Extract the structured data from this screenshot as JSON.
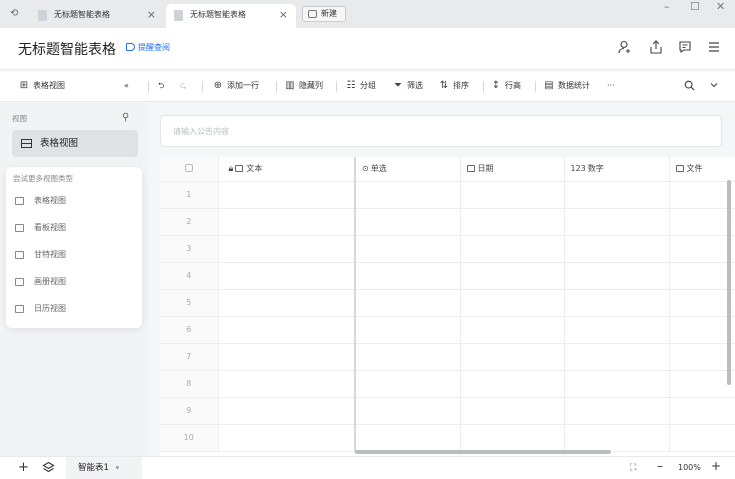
{
  "tabs": [
    {
      "label": "无标题智能表格"
    },
    {
      "label": "无标题智能表格"
    }
  ],
  "new_tab_label": "新建",
  "window_controls": {
    "minimize": "–",
    "maximize": "☐",
    "close": "✕"
  },
  "header": {
    "title": "无标题智能表格",
    "remind_label": "提醒查阅"
  },
  "toolbar": {
    "view_label": "表格视图",
    "add_row": "添加一行",
    "hide_columns": "隐藏列",
    "group": "分组",
    "filter": "筛选",
    "sort": "排序",
    "row_height": "行高",
    "stats": "数据统计",
    "more": "···"
  },
  "sidebar": {
    "section_label": "视图",
    "active_view": "表格视图",
    "more_types_title": "尝试更多视图类型",
    "view_types": [
      "表格视图",
      "看板视图",
      "甘特视图",
      "画册视图",
      "日历视图"
    ]
  },
  "search": {
    "placeholder": "请输入公告内容"
  },
  "grid": {
    "columns": [
      "文本",
      "单选",
      "日期",
      "数字",
      "文件"
    ],
    "number_prefix": "123",
    "rows": [
      "1",
      "2",
      "3",
      "4",
      "5",
      "6",
      "7",
      "8",
      "9",
      "10"
    ]
  },
  "bottom": {
    "sheet_name": "智能表1",
    "zoom": "100%"
  }
}
